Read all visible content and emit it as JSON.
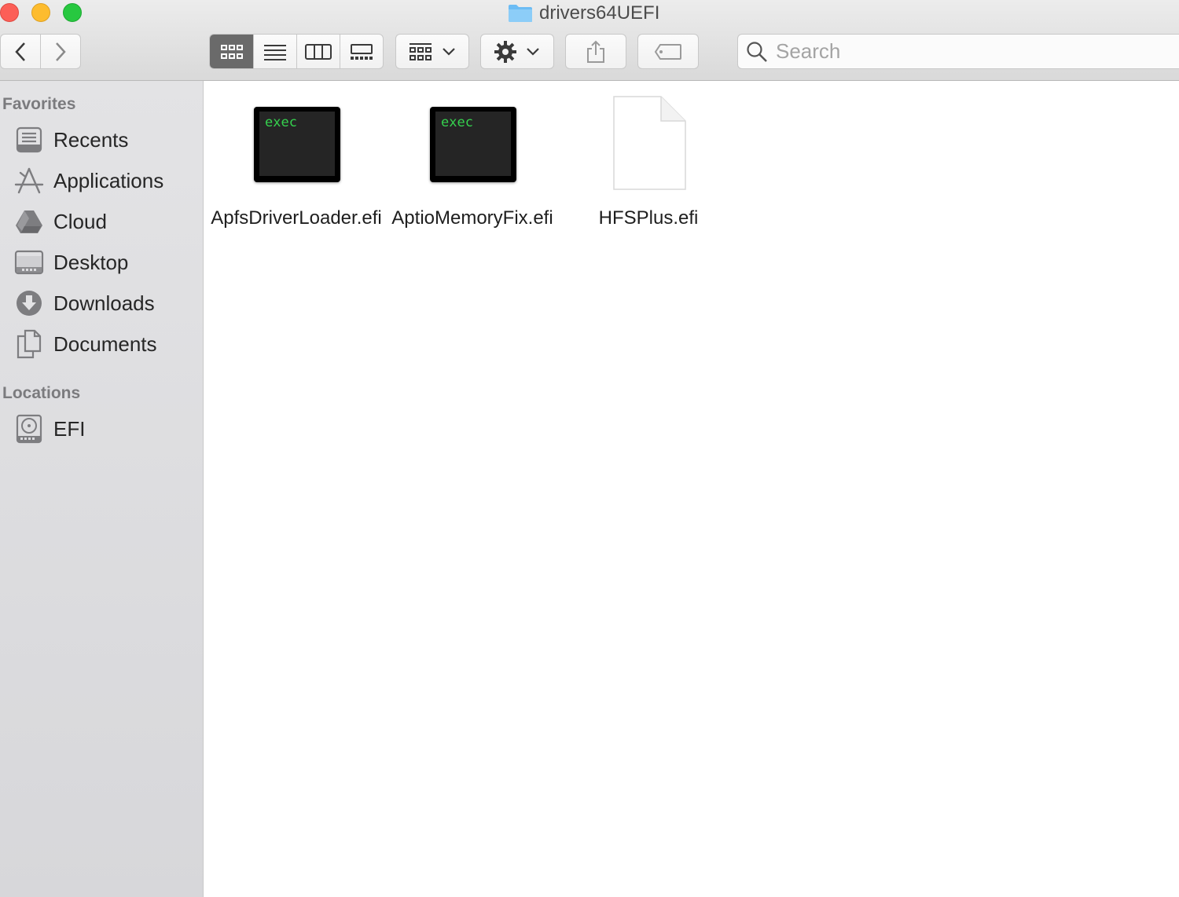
{
  "window": {
    "title": "drivers64UEFI"
  },
  "toolbar": {
    "search_placeholder": "Search",
    "active_view": "icon"
  },
  "sidebar": {
    "favorites_header": "Favorites",
    "favorites": [
      {
        "label": "Recents",
        "icon": "recents-icon"
      },
      {
        "label": "Applications",
        "icon": "applications-icon"
      },
      {
        "label": "Cloud",
        "icon": "cloud-drive-icon"
      },
      {
        "label": "Desktop",
        "icon": "desktop-icon"
      },
      {
        "label": "Downloads",
        "icon": "downloads-icon"
      },
      {
        "label": "Documents",
        "icon": "documents-icon"
      }
    ],
    "locations_header": "Locations",
    "locations": [
      {
        "label": "EFI",
        "icon": "disk-icon"
      }
    ]
  },
  "files": [
    {
      "name": "ApfsDriverLoader.efi",
      "icon": "exec-icon",
      "icon_text": "exec"
    },
    {
      "name": "AptioMemoryFix.efi",
      "icon": "exec-icon",
      "icon_text": "exec"
    },
    {
      "name": "HFSPlus.efi",
      "icon": "document-icon"
    }
  ],
  "colors": {
    "exec_text": "#35d14e",
    "folder_blue": "#6cbcf4",
    "active_view_bg": "#6a6a6a"
  }
}
